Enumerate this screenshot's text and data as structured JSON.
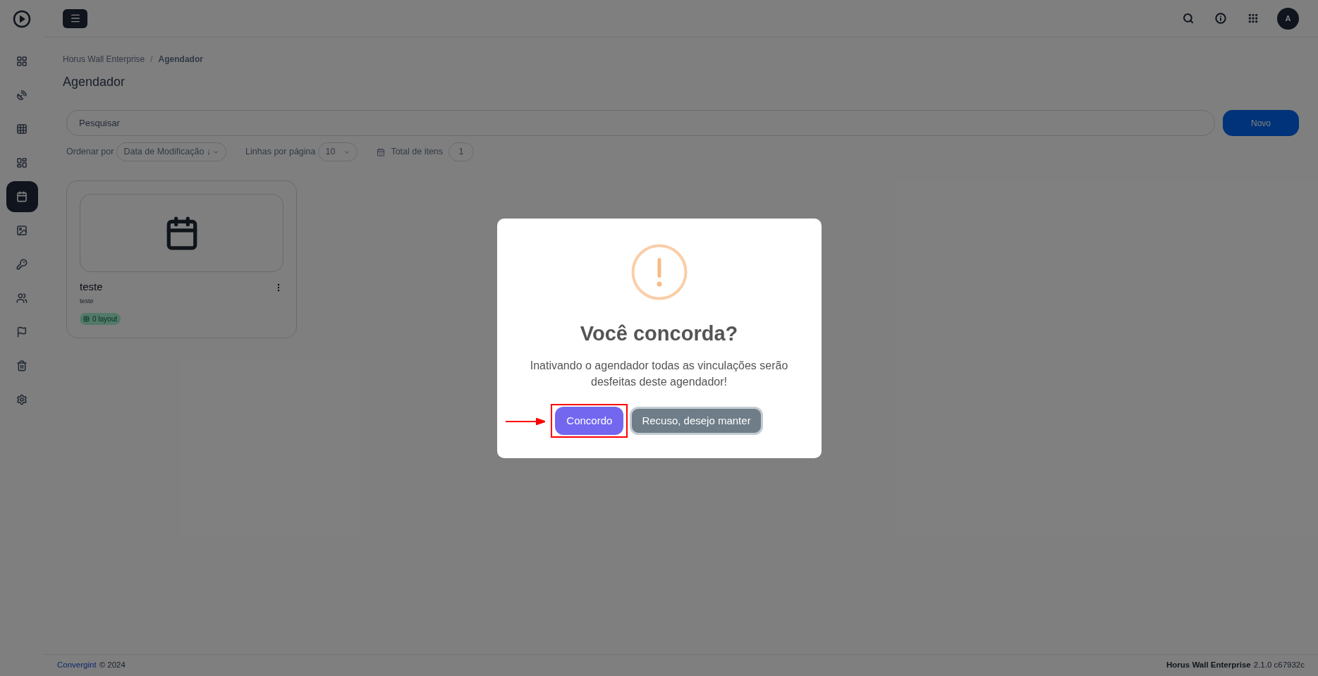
{
  "header": {
    "avatar": "A"
  },
  "sidebar": {
    "items": [
      {
        "kind": "dashboard",
        "selected": false
      },
      {
        "kind": "satellite",
        "selected": false
      },
      {
        "kind": "grid",
        "selected": false
      },
      {
        "kind": "dotted-grid",
        "selected": false
      },
      {
        "kind": "calendar",
        "selected": true
      },
      {
        "kind": "image",
        "selected": false
      },
      {
        "kind": "key",
        "selected": false
      },
      {
        "kind": "users",
        "selected": false
      },
      {
        "kind": "flag",
        "selected": false
      },
      {
        "kind": "trash",
        "selected": false
      },
      {
        "kind": "settings",
        "selected": false
      }
    ]
  },
  "breadcrumb": {
    "items": [
      "Horus Wall Enterprise",
      "Agendador"
    ],
    "separator": "/"
  },
  "title": "Agendador",
  "search": {
    "placeholder": "Pesquisar"
  },
  "new_button": "Novo",
  "sort": {
    "label": "Ordenar por",
    "value": "Data de Modificação ↓"
  },
  "rows_per_page": {
    "label": "Linhas por página",
    "value": "10"
  },
  "total": {
    "label": "Total de itens",
    "value": "1"
  },
  "cards": [
    {
      "title": "teste",
      "subtitle": "teste",
      "badge": "0 layout"
    }
  ],
  "footer": {
    "company": "Convergint",
    "copyright": "© 2024",
    "product": "Horus Wall Enterprise",
    "version": "2.1.0 c67932c"
  },
  "dialog": {
    "title": "Você concorda?",
    "message": "Inativando o agendador todas as vinculações serão desfeitas deste agendador!",
    "confirm": "Concordo",
    "cancel": "Recuso, desejo manter"
  }
}
